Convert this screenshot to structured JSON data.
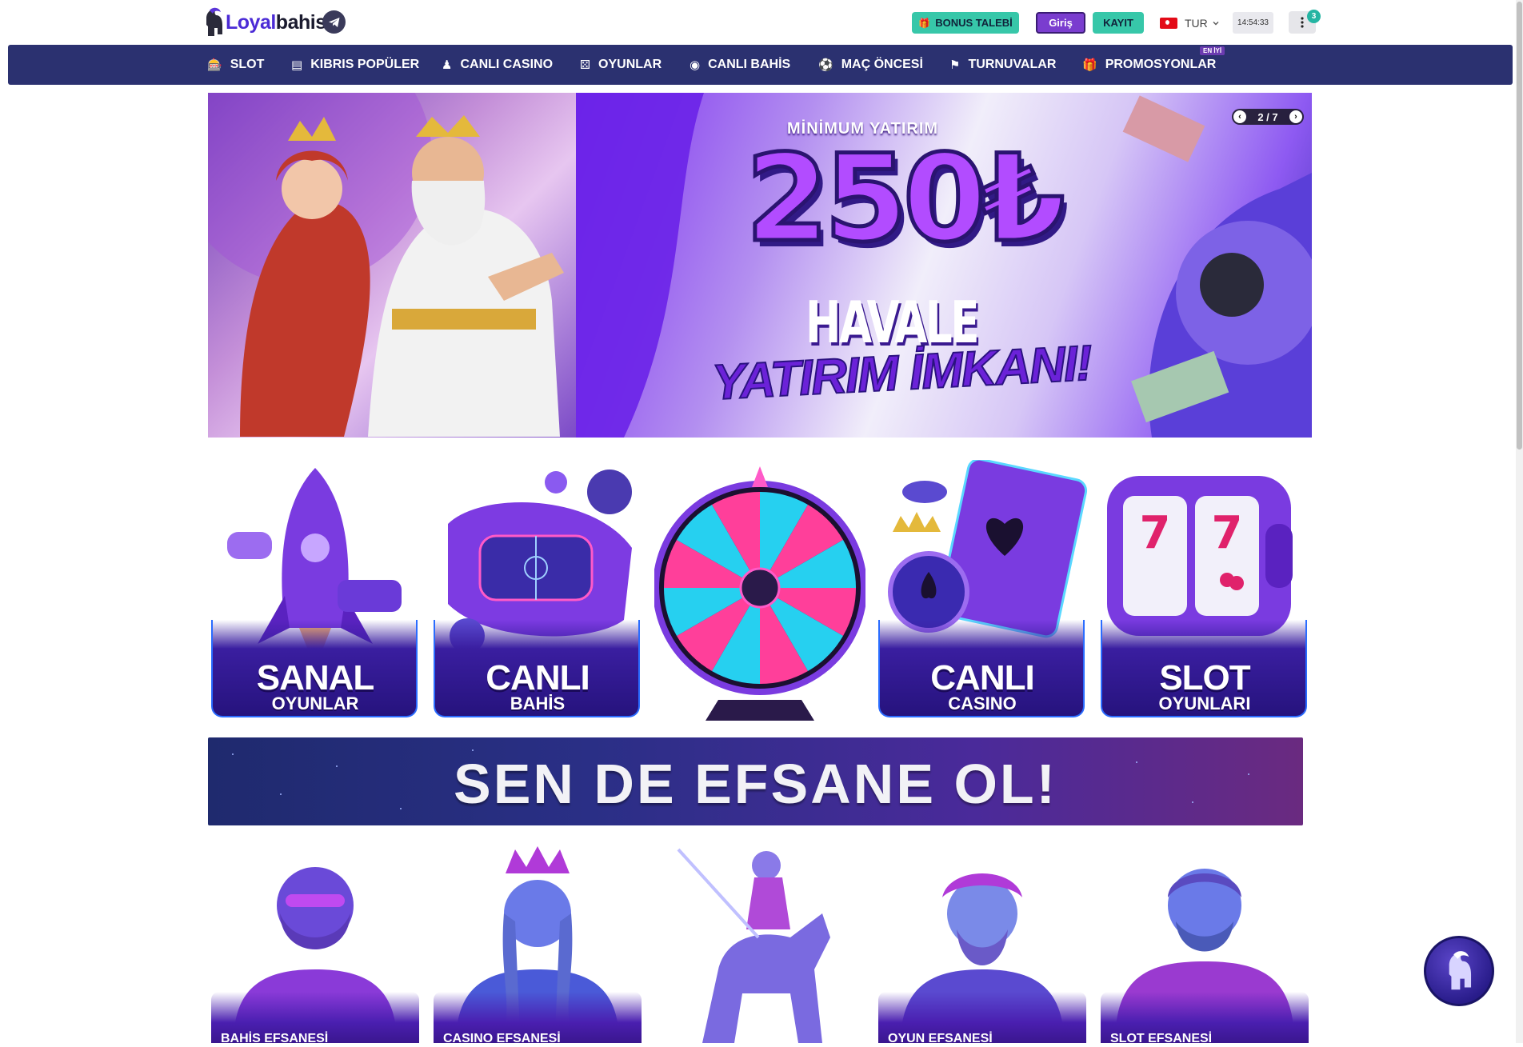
{
  "header": {
    "logo": {
      "part1": "Loyal",
      "part2": "bahis"
    },
    "bonus_button": "BONUS TALEBİ",
    "login_button": "Giriş",
    "register_button": "KAYIT",
    "language": "TUR",
    "clock": "14:54:33",
    "notification_count": "3",
    "icons": {
      "telegram": "telegram-icon",
      "gift": "gift-icon",
      "menu": "more-vertical-icon",
      "flag": "turkey-flag-icon"
    }
  },
  "nav": {
    "items": [
      {
        "label": "SLOT",
        "icon": "slot-icon"
      },
      {
        "label": "KIBRIS POPÜLER",
        "icon": "ticket-icon"
      },
      {
        "label": "CANLI CASINO",
        "icon": "dealer-icon"
      },
      {
        "label": "OYUNLAR",
        "icon": "dice-icon"
      },
      {
        "label": "CANLI BAHİS",
        "icon": "live-icon"
      },
      {
        "label": "MAÇ ÖNCESİ",
        "icon": "football-icon"
      },
      {
        "label": "TURNUVALAR",
        "icon": "tournament-icon"
      },
      {
        "label": "PROMOSYONLAR",
        "icon": "gift-icon"
      }
    ],
    "promo_badge": "EN İYİ"
  },
  "hero": {
    "line1": "MİNİMUM YATIRIM",
    "amount": "250₺",
    "line2": "HAVALE",
    "line3": "YATIRIM İMKANI!",
    "slide_indicator": "2 / 7"
  },
  "categories": [
    {
      "title": "SANAL",
      "subtitle": "OYUNLAR"
    },
    {
      "title": "CANLI",
      "subtitle": "BAHİS"
    },
    {
      "title": "",
      "subtitle": ""
    },
    {
      "title": "CANLI",
      "subtitle": "CASINO"
    },
    {
      "title": "SLOT",
      "subtitle": "OYUNLARI"
    }
  ],
  "banner": {
    "text": "SEN DE EFSANE OL!"
  },
  "legends": [
    {
      "label": "BAHİS EFSANESİ"
    },
    {
      "label": "CASINO EFSANESİ"
    },
    {
      "label": ""
    },
    {
      "label": "OYUN EFSANESİ"
    },
    {
      "label": "SLOT EFSANESİ"
    }
  ],
  "colors": {
    "nav_bg": "#2b3170",
    "accent_teal": "#37c7a9",
    "accent_purple": "#7a3dcf",
    "brand_blue": "#4b2bd6"
  }
}
